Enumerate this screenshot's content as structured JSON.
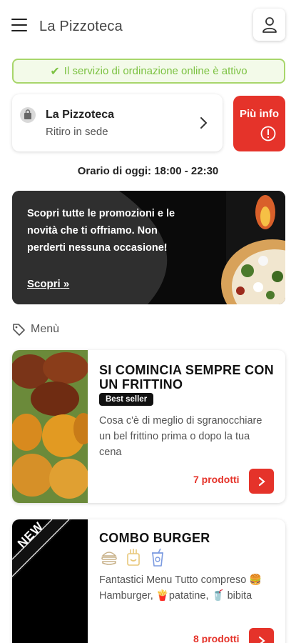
{
  "header": {
    "title": "La Pizzoteca",
    "menu_icon": "hamburger-menu-icon",
    "user_icon": "user-icon"
  },
  "status": {
    "text": "Il servizio di ordinazione online è attivo",
    "icon": "check-icon",
    "color": "#7cc242"
  },
  "store": {
    "name": "La Pizzoteca",
    "mode": "Ritiro in sede",
    "icon": "shopping-bag-icon"
  },
  "info_button": {
    "label": "Più info",
    "icon": "info-circle-icon"
  },
  "hours": {
    "text": "Orario di oggi: 18:00 - 22:30"
  },
  "promo": {
    "text": "Scopri tutte le promozioni e le novità che ti offriamo. Non perderti nessuna occasione!",
    "link_label": "Scopri",
    "link_icon": "double-chevron-right-icon"
  },
  "menu": {
    "heading": "Menù",
    "heading_icon": "tag-icon",
    "categories": [
      {
        "title": "SI COMINCIA SEMPRE CON UN FRITTINO",
        "badge": "Best seller",
        "description": "Cosa c'è di meglio di sgranocchiare un bel frittino prima o dopo la tua cena",
        "count": "7 prodotti"
      },
      {
        "title": "COMBO BURGER",
        "image_label": "NEW",
        "icons": [
          "burger-icon",
          "fries-icon",
          "drink-icon"
        ],
        "description": "Fantastici Menu Tutto compreso 🍔Hamburger, 🍟patatine, 🥤 bibita",
        "count": "8 prodotti"
      }
    ]
  },
  "colors": {
    "accent": "#e5332a",
    "success": "#7cc242"
  }
}
